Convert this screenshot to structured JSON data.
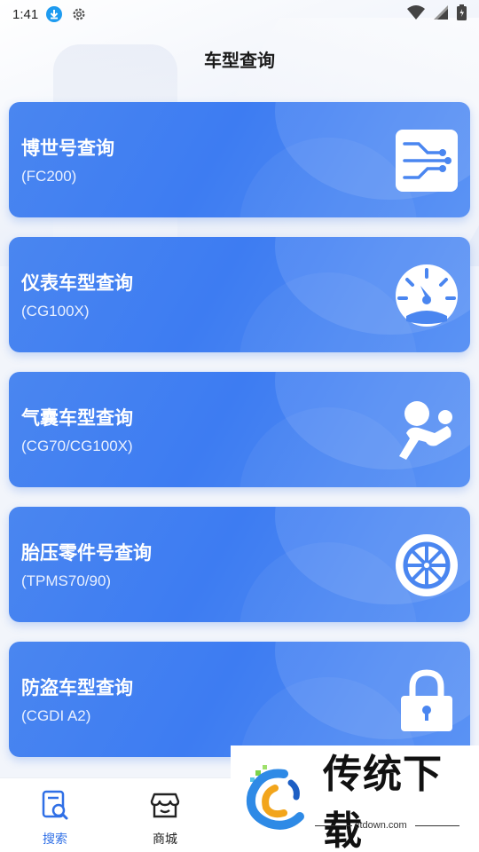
{
  "status": {
    "time": "1:41"
  },
  "header": {
    "title": "车型查询"
  },
  "cards": [
    {
      "title": "博世号查询",
      "subtitle": "(FC200)",
      "icon": "circuit-icon"
    },
    {
      "title": "仪表车型查询",
      "subtitle": "(CG100X)",
      "icon": "gauge-icon"
    },
    {
      "title": "气囊车型查询",
      "subtitle": "(CG70/CG100X)",
      "icon": "airbag-icon"
    },
    {
      "title": "胎压零件号查询",
      "subtitle": "(TPMS70/90)",
      "icon": "tire-icon"
    },
    {
      "title": "防盗车型查询",
      "subtitle": "(CGDI A2)",
      "icon": "lock-icon"
    }
  ],
  "tabs": [
    {
      "label": "搜索",
      "icon": "search-doc-icon",
      "active": true
    },
    {
      "label": "商城",
      "icon": "store-icon",
      "active": false
    }
  ],
  "watermark": {
    "text": "传统下载",
    "url": "ctdown.com"
  },
  "colors": {
    "accent": "#2f6fe6",
    "card": "#4a86f0"
  }
}
